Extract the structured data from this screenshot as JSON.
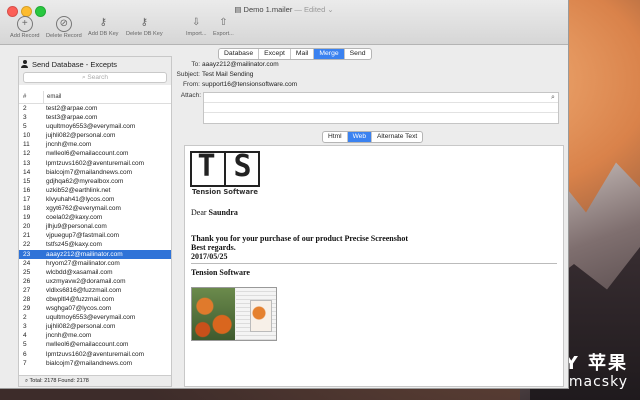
{
  "window": {
    "title": "Demo 1.mailer",
    "edited": "— Edited ⌄"
  },
  "toolbar": {
    "add_record": "Add Record",
    "delete_record": "Delete Record",
    "add_db_key": "Add DB Key",
    "delete_db_key": "Delete DB Key",
    "import": "Import...",
    "export": "Export..."
  },
  "sidebar": {
    "title": "Send Database - Excepts",
    "search_placeholder": "Search",
    "col_num": "#",
    "col_email": "email",
    "rows": [
      {
        "n": "2",
        "e": "test2@arpae.com"
      },
      {
        "n": "3",
        "e": "test3@arpae.com"
      },
      {
        "n": "5",
        "e": "uqultmoy6553@everymail.com"
      },
      {
        "n": "10",
        "e": "jujhli082@personal.com"
      },
      {
        "n": "11",
        "e": "jncnh@me.com"
      },
      {
        "n": "12",
        "e": "nwlleol6@emailaccount.com"
      },
      {
        "n": "13",
        "e": "lpmtzuvs1602@aventuremail.com"
      },
      {
        "n": "14",
        "e": "bialcojm7@mailandnews.com"
      },
      {
        "n": "15",
        "e": "gdjhqa62@myrealbox.com"
      },
      {
        "n": "16",
        "e": "uzkib52@earthlink.net"
      },
      {
        "n": "17",
        "e": "klvyuhah41@lycos.com"
      },
      {
        "n": "18",
        "e": "xgyt6762@everymail.com"
      },
      {
        "n": "19",
        "e": "coela02@kaxy.com"
      },
      {
        "n": "20",
        "e": "jlhju9@personal.com"
      },
      {
        "n": "21",
        "e": "vjpuegup7@fastmail.com"
      },
      {
        "n": "22",
        "e": "tstfsz45@kaxy.com"
      },
      {
        "n": "23",
        "e": "aaayz212@mailinator.com"
      },
      {
        "n": "24",
        "e": "hryom27@mailinator.com"
      },
      {
        "n": "25",
        "e": "wlcbdd@xasamail.com"
      },
      {
        "n": "26",
        "e": "uxzmyavw2@doramail.com"
      },
      {
        "n": "27",
        "e": "vldlxs6816@fuzzmail.com"
      },
      {
        "n": "28",
        "e": "cbwpltl4@fuzzmail.com"
      },
      {
        "n": "29",
        "e": "wsghga07@lycos.com"
      },
      {
        "n": "2",
        "e": "uqultmoy6553@everymail.com"
      },
      {
        "n": "3",
        "e": "jujhli082@personal.com"
      },
      {
        "n": "4",
        "e": "jncnh@me.com"
      },
      {
        "n": "5",
        "e": "nwlleol6@emailaccount.com"
      },
      {
        "n": "6",
        "e": "lpmtzuvs1602@aventuremail.com"
      },
      {
        "n": "7",
        "e": "bialcojm7@mailandnews.com"
      }
    ],
    "selected_index": 16,
    "footer": "Total: 2178   Found: 2178"
  },
  "tabs": [
    "Database",
    "Except",
    "Mail",
    "Merge",
    "Send"
  ],
  "active_tab": "Merge",
  "headers": {
    "to_label": "To:",
    "to_value": "aaayz212@mailinator.com",
    "subject_label": "Subject:",
    "subject_value": "Test Mail Sending",
    "from_label": "From:",
    "from_value": "support16@tensionsoftware.com",
    "attach_label": "Attach:"
  },
  "format_tabs": [
    "Html",
    "Web",
    "Alternate Text"
  ],
  "active_format": "Web",
  "message": {
    "logo_t": "T",
    "logo_s": "S",
    "logo_sub": "Tension Software",
    "dear": "Dear",
    "name": "Saundra",
    "thanks": "Thank you for your purchase of our product Precise Screenshot",
    "regards": "Best regards.",
    "date": "2017/05/25",
    "company": "Tension Software"
  },
  "watermark": {
    "line1": "MACSKY 苹果",
    "line2": "http://www.macsky"
  }
}
